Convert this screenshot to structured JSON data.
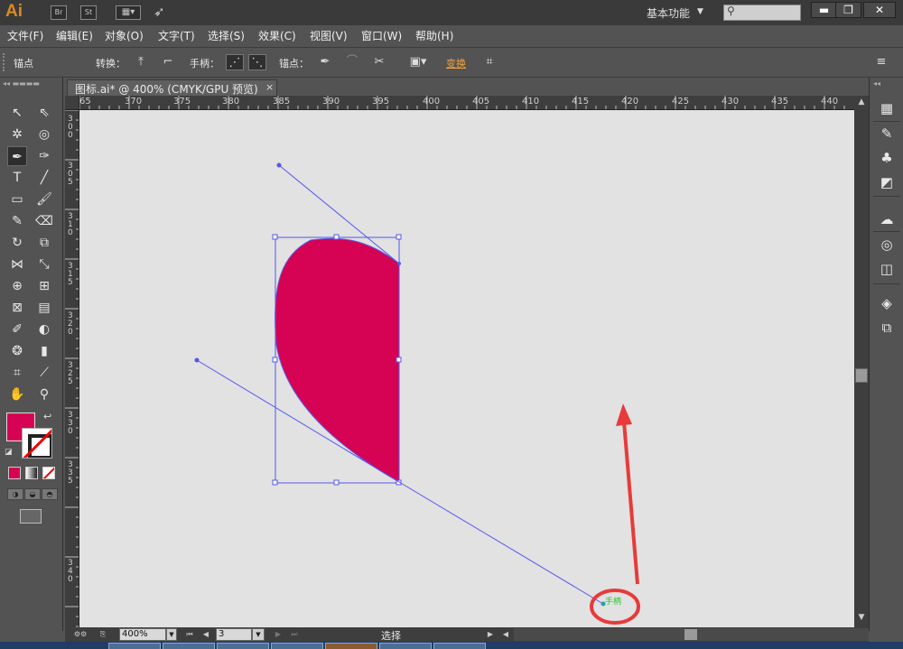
{
  "app": {
    "logo_text": "Ai",
    "badge_br": "Br",
    "badge_st": "St",
    "workspace": "基本功能",
    "brand_color": "#d98a1e"
  },
  "window_controls": {
    "minimize": "▬",
    "restore": "❐",
    "close": "✕"
  },
  "menu": [
    "文件(F)",
    "编辑(E)",
    "对象(O)",
    "文字(T)",
    "选择(S)",
    "效果(C)",
    "视图(V)",
    "窗口(W)",
    "帮助(H)"
  ],
  "control_bar": {
    "title": "锚点",
    "convert_label": "转换：",
    "handle_label": "手柄：",
    "anchor_label": "锚点：",
    "transform_label": "变换"
  },
  "document": {
    "tab_title": "图标.ai* @ 400% (CMYK/GPU 预览)",
    "close_glyph": "×"
  },
  "rulers": {
    "horizontal": [
      "65",
      "370",
      "375",
      "380",
      "385",
      "390",
      "395",
      "400",
      "405",
      "410",
      "415",
      "420",
      "425",
      "430",
      "435",
      "440"
    ],
    "vertical": [
      "300",
      "305",
      "310",
      "315",
      "320",
      "325",
      "330",
      "335",
      "340"
    ]
  },
  "canvas": {
    "shape_fill": "#d60254",
    "path_color": "#5555ee",
    "annotation_color": "#e83a3a",
    "handle_label": "手柄"
  },
  "tools": {
    "fill_color": "#d60254",
    "stroke": "none"
  },
  "status_bar": {
    "zoom": "400%",
    "page": "3",
    "status": "选择"
  }
}
